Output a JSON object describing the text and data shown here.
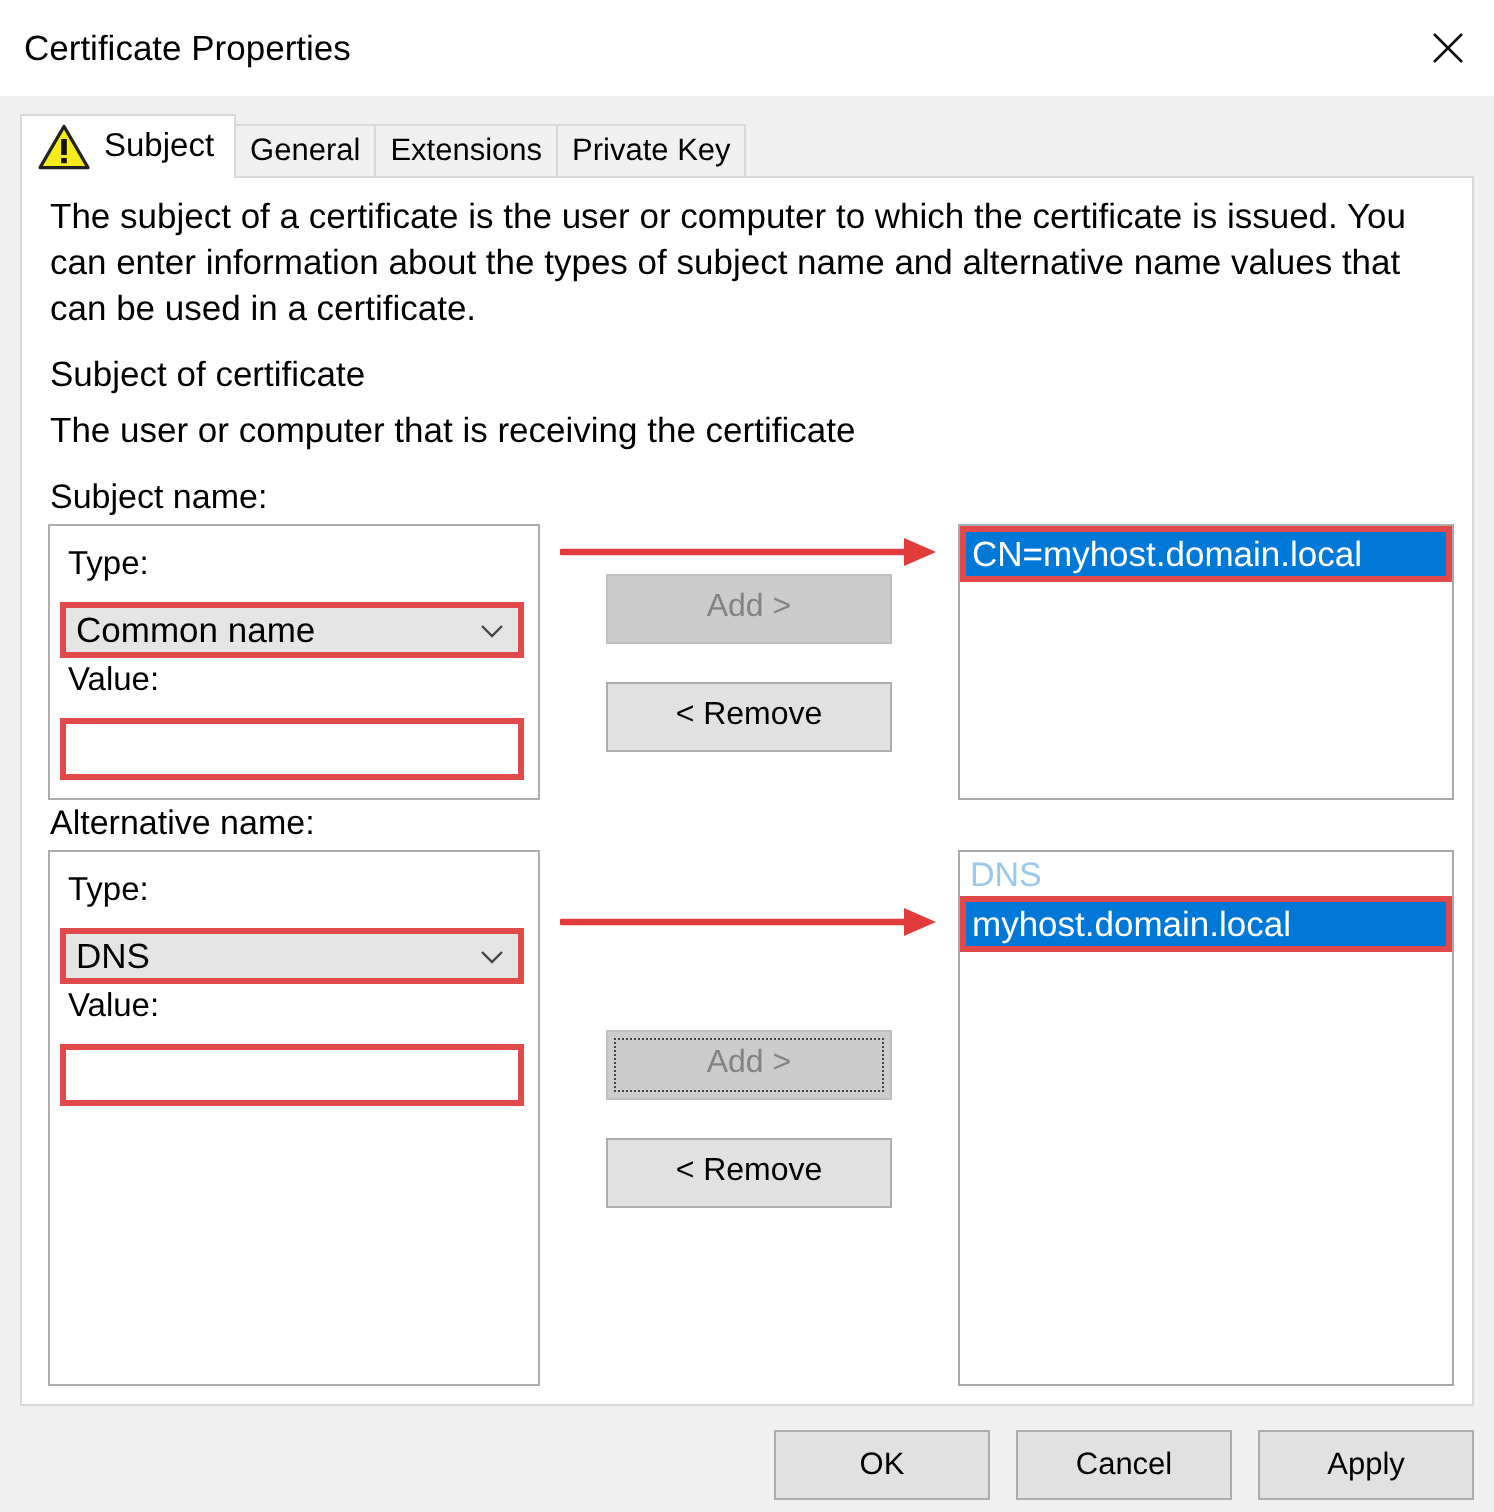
{
  "window": {
    "title": "Certificate Properties"
  },
  "tabs": [
    {
      "label": "Subject",
      "selected": true,
      "warning": true
    },
    {
      "label": "General",
      "selected": false,
      "warning": false
    },
    {
      "label": "Extensions",
      "selected": false,
      "warning": false
    },
    {
      "label": "Private Key",
      "selected": false,
      "warning": false
    }
  ],
  "subject_page": {
    "description": "The subject of a certificate is the user or computer to which the certificate is issued. You can enter information about the types of subject name and alternative name values that can be used in a certificate.",
    "heading": "Subject of certificate",
    "subheading": "The user or computer that is receiving the certificate",
    "sections": [
      {
        "label": "Subject name:",
        "type": {
          "label": "Type:",
          "value": "Common name",
          "highlighted": true
        },
        "value": {
          "label": "Value:",
          "highlighted": true
        },
        "buttons": [
          {
            "label": "Add >",
            "disabled": true,
            "focused": false
          },
          {
            "label": "< Remove",
            "disabled": false,
            "focused": false
          }
        ],
        "list": {
          "items": [
            {
              "text": "CN=myhost.domain.local",
              "selected": true,
              "highlighted": true,
              "arrow": true
            }
          ]
        }
      },
      {
        "label": "Alternative name:",
        "type": {
          "label": "Type:",
          "value": "DNS",
          "highlighted": true
        },
        "value": {
          "label": "Value:",
          "highlighted": true
        },
        "buttons": [
          {
            "label": "Add >",
            "disabled": true,
            "focused": true
          },
          {
            "label": "< Remove",
            "disabled": false,
            "focused": false
          }
        ],
        "list": {
          "group_label": "DNS",
          "items": [
            {
              "text": "myhost.domain.local",
              "selected": true,
              "highlighted": true,
              "arrow": true
            }
          ]
        }
      }
    ]
  },
  "buttons": [
    "OK",
    "Cancel",
    "Apply"
  ]
}
